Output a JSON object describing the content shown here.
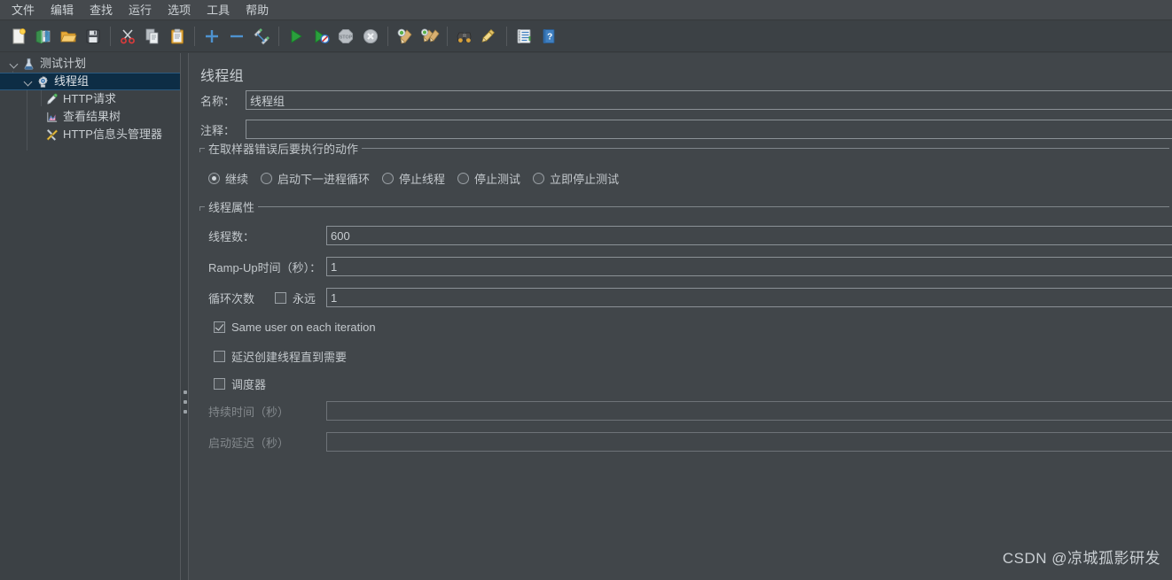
{
  "menu": {
    "items": [
      {
        "label": "文件",
        "name": "menu-file"
      },
      {
        "label": "编辑",
        "name": "menu-edit"
      },
      {
        "label": "查找",
        "name": "menu-search"
      },
      {
        "label": "运行",
        "name": "menu-run"
      },
      {
        "label": "选项",
        "name": "menu-options"
      },
      {
        "label": "工具",
        "name": "menu-tools"
      },
      {
        "label": "帮助",
        "name": "menu-help"
      }
    ]
  },
  "toolbar": {
    "buttons": [
      {
        "icon": "new-file-icon",
        "title": "新建"
      },
      {
        "icon": "templates-icon",
        "title": "模板"
      },
      {
        "icon": "open-folder-icon",
        "title": "打开"
      },
      {
        "icon": "save-icon",
        "title": "保存"
      },
      {
        "sep": true
      },
      {
        "icon": "cut-scissors-icon",
        "title": "剪切"
      },
      {
        "icon": "copy-icon",
        "title": "复制"
      },
      {
        "icon": "paste-clipboard-icon",
        "title": "粘贴"
      },
      {
        "sep": true
      },
      {
        "icon": "expand-all-plus-icon",
        "title": "展开全部"
      },
      {
        "icon": "collapse-all-minus-icon",
        "title": "收起全部"
      },
      {
        "icon": "toggle-enable-icon",
        "title": "启用/禁用"
      },
      {
        "sep": true
      },
      {
        "icon": "start-play-icon",
        "title": "启动"
      },
      {
        "icon": "start-no-pauses-icon",
        "title": "无间隔启动"
      },
      {
        "icon": "stop-icon",
        "title": "停止"
      },
      {
        "icon": "shutdown-icon",
        "title": "关闭"
      },
      {
        "sep": true
      },
      {
        "icon": "clear-broom-icon",
        "title": "清除"
      },
      {
        "icon": "clear-all-brooms-icon",
        "title": "清除全部"
      },
      {
        "sep": true
      },
      {
        "icon": "search-binoculars-icon",
        "title": "查找"
      },
      {
        "icon": "reset-search-broom-icon",
        "title": "重置查找"
      },
      {
        "sep": true
      },
      {
        "icon": "function-helper-icon",
        "title": "函数助手对话框"
      },
      {
        "icon": "help-book-icon",
        "title": "帮助"
      }
    ]
  },
  "tree": {
    "nodes": [
      {
        "label": "测试计划",
        "icon": "test-plan-flask-icon",
        "depth": 0,
        "expanded": true,
        "selected": false,
        "name": "tree-node-test-plan"
      },
      {
        "label": "线程组",
        "icon": "thread-group-gear-icon",
        "depth": 1,
        "expanded": true,
        "selected": true,
        "name": "tree-node-thread-group"
      },
      {
        "label": "HTTP请求",
        "icon": "http-request-pipette-icon",
        "depth": 2,
        "expanded": false,
        "selected": false,
        "name": "tree-node-http-request"
      },
      {
        "label": "查看结果树",
        "icon": "view-results-tree-chart-icon",
        "depth": 2,
        "expanded": false,
        "selected": false,
        "name": "tree-node-view-results-tree"
      },
      {
        "label": "HTTP信息头管理器",
        "icon": "http-header-manager-tools-icon",
        "depth": 2,
        "expanded": false,
        "selected": false,
        "name": "tree-node-http-header-manager"
      }
    ]
  },
  "panel": {
    "title": "线程组",
    "name_label": "名称：",
    "name_value": "线程组",
    "comment_label": "注释：",
    "comment_value": "",
    "error_action": {
      "legend": "在取样器错误后要执行的动作",
      "options": [
        {
          "label": "继续",
          "selected": true,
          "name": "radio-continue"
        },
        {
          "label": "启动下一进程循环",
          "selected": false,
          "name": "radio-start-next-loop"
        },
        {
          "label": "停止线程",
          "selected": false,
          "name": "radio-stop-thread"
        },
        {
          "label": "停止测试",
          "selected": false,
          "name": "radio-stop-test"
        },
        {
          "label": "立即停止测试",
          "selected": false,
          "name": "radio-stop-test-now"
        }
      ]
    },
    "thread_properties": {
      "legend": "线程属性",
      "num_threads_label": "线程数：",
      "num_threads_value": "600",
      "ramp_up_label": "Ramp-Up时间（秒）：",
      "ramp_up_value": "1",
      "loop_count_label": "循环次数",
      "forever_label": "永远",
      "forever_checked": false,
      "loop_count_value": "1",
      "same_user_label": "Same user on each iteration",
      "same_user_checked": true,
      "delayed_start_label": "延迟创建线程直到需要",
      "delayed_start_checked": false,
      "scheduler_label": "调度器",
      "scheduler_checked": false,
      "duration_label": "持续时间（秒）",
      "duration_value": "",
      "startup_delay_label": "启动延迟（秒）",
      "startup_delay_value": ""
    }
  },
  "watermark": "CSDN @凉城孤影研发",
  "colors": {
    "window_bg": "#3c4145",
    "panel_bg": "#41464a",
    "menubar_bg": "#45494d",
    "text": "#c3c8cc",
    "selection_bg": "#0d2d45",
    "selection_border": "#2b5b80",
    "field_border": "#8b9196"
  }
}
